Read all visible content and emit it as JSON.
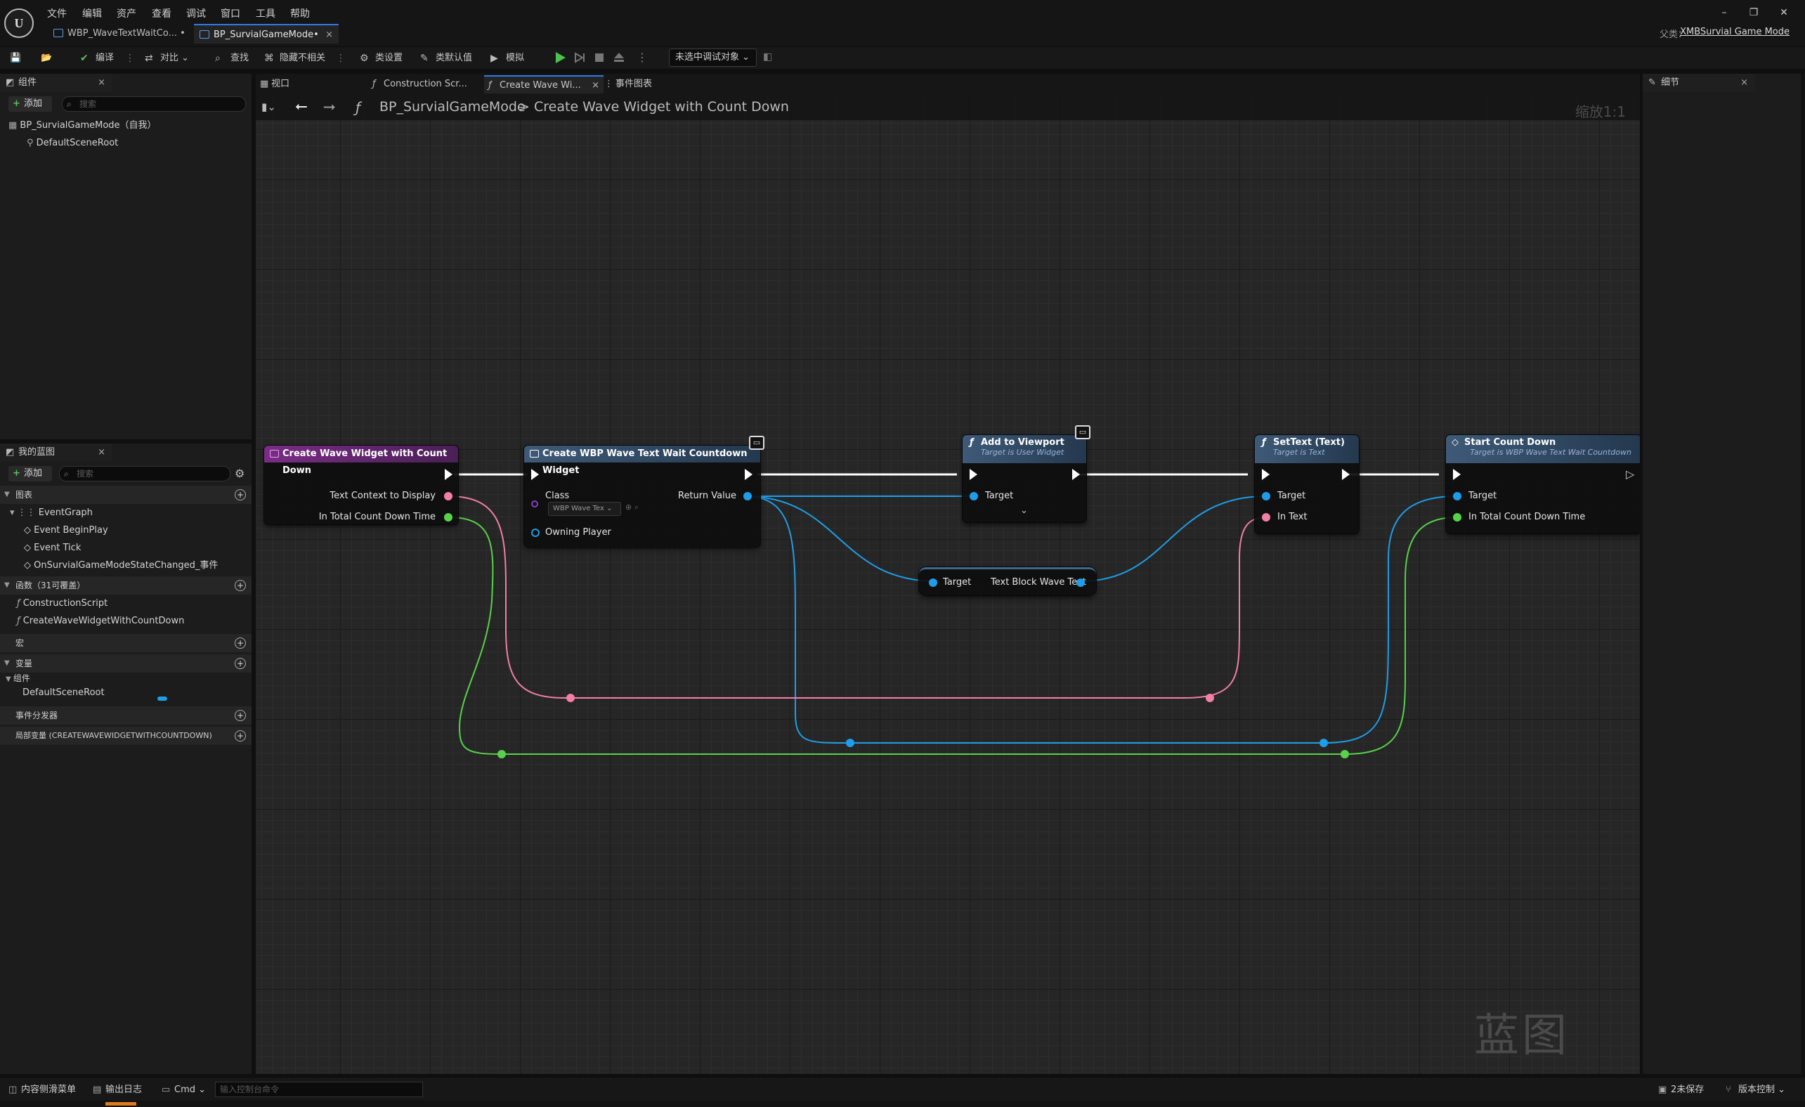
{
  "menu": [
    "文件",
    "编辑",
    "资产",
    "查看",
    "调试",
    "窗口",
    "工具",
    "帮助"
  ],
  "doc_tabs": [
    {
      "label": "WBP_WaveTextWaitCo... •",
      "close": ""
    },
    {
      "label": "BP_SurvialGameMode•",
      "close": "×"
    }
  ],
  "window_controls": {
    "minimize": "–",
    "restore": "❐",
    "close": "✕"
  },
  "parent": {
    "label": "父类：",
    "link": "XMBSurvial Game Mode"
  },
  "toolbar": {
    "compile": "编译",
    "diff": "对比",
    "find": "查找",
    "hide_unrelated": "隐藏不相关",
    "class_settings": "类设置",
    "class_defaults": "类默认值",
    "simulate": "模拟",
    "debug_object": "未选中调试对象"
  },
  "components_panel": {
    "tab": "组件",
    "add": "添加",
    "search_placeholder": "搜索",
    "root": "BP_SurvialGameMode（自我）",
    "child": "DefaultSceneRoot"
  },
  "my_blueprint": {
    "tab": "我的蓝图",
    "add": "添加",
    "search_placeholder": "搜索",
    "sections": {
      "graphs": "图表",
      "functions": "函数（31可覆盖）",
      "macros": "宏",
      "variables": "变量",
      "components": "组件",
      "dispatchers": "事件分发器",
      "locals": "局部变量 (CREATEWAVEWIDGETWITHCOUNTDOWN)"
    },
    "graph_items": [
      "EventGraph",
      "Event BeginPlay",
      "Event Tick",
      "OnSurvialGameModeStateChanged_事件"
    ],
    "function_items": [
      "ConstructionScript",
      "CreateWaveWidgetWithCountDown"
    ],
    "variable_items": [
      "DefaultSceneRoot"
    ]
  },
  "graph_tabs": [
    "视口",
    "Construction Scr...",
    "Create Wave Wi...",
    "事件图表"
  ],
  "graph_tab_close": "×",
  "breadcrumb": {
    "root": "BP_SurvialGameMode",
    "sep": ">",
    "current": "Create Wave Widget with Count Down"
  },
  "zoom": "缩放1:1",
  "watermark": "蓝图",
  "nodes": {
    "entry": {
      "title": "Create Wave Widget with Count Down",
      "pins": [
        "Text Context to Display",
        "In Total Count Down Time"
      ]
    },
    "create_widget": {
      "title": "Create WBP Wave Text Wait Countdown Widget",
      "class_label": "Class",
      "class_value": "WBP Wave Tex",
      "owning_player": "Owning Player",
      "return_value": "Return Value"
    },
    "add_viewport": {
      "title": "Add to Viewport",
      "subtitle": "Target is User Widget",
      "target": "Target"
    },
    "get_text_block": {
      "target": "Target",
      "output": "Text Block Wave Text"
    },
    "set_text": {
      "title": "SetText (Text)",
      "subtitle": "Target is Text",
      "target": "Target",
      "in_text": "In Text"
    },
    "start_countdown": {
      "title": "Start Count Down",
      "subtitle": "Target is WBP Wave Text Wait Countdown",
      "target": "Target",
      "time": "In Total Count Down Time"
    }
  },
  "details_panel": {
    "tab": "细节"
  },
  "statusbar": {
    "content_drawer": "内容侧滑菜单",
    "output_log": "输出日志",
    "cmd": "Cmd",
    "cmd_placeholder": "输入控制台命令",
    "unsaved": "2未保存",
    "source_control": "版本控制"
  },
  "colors": {
    "exec": "#ffffff",
    "object_wire": "#1e9ee8",
    "text_wire": "#f27fa5",
    "float_wire": "#58d24a",
    "function_header": "#7a2c86",
    "call_header": "#3e5a78",
    "accent": "#2f7ae5"
  }
}
